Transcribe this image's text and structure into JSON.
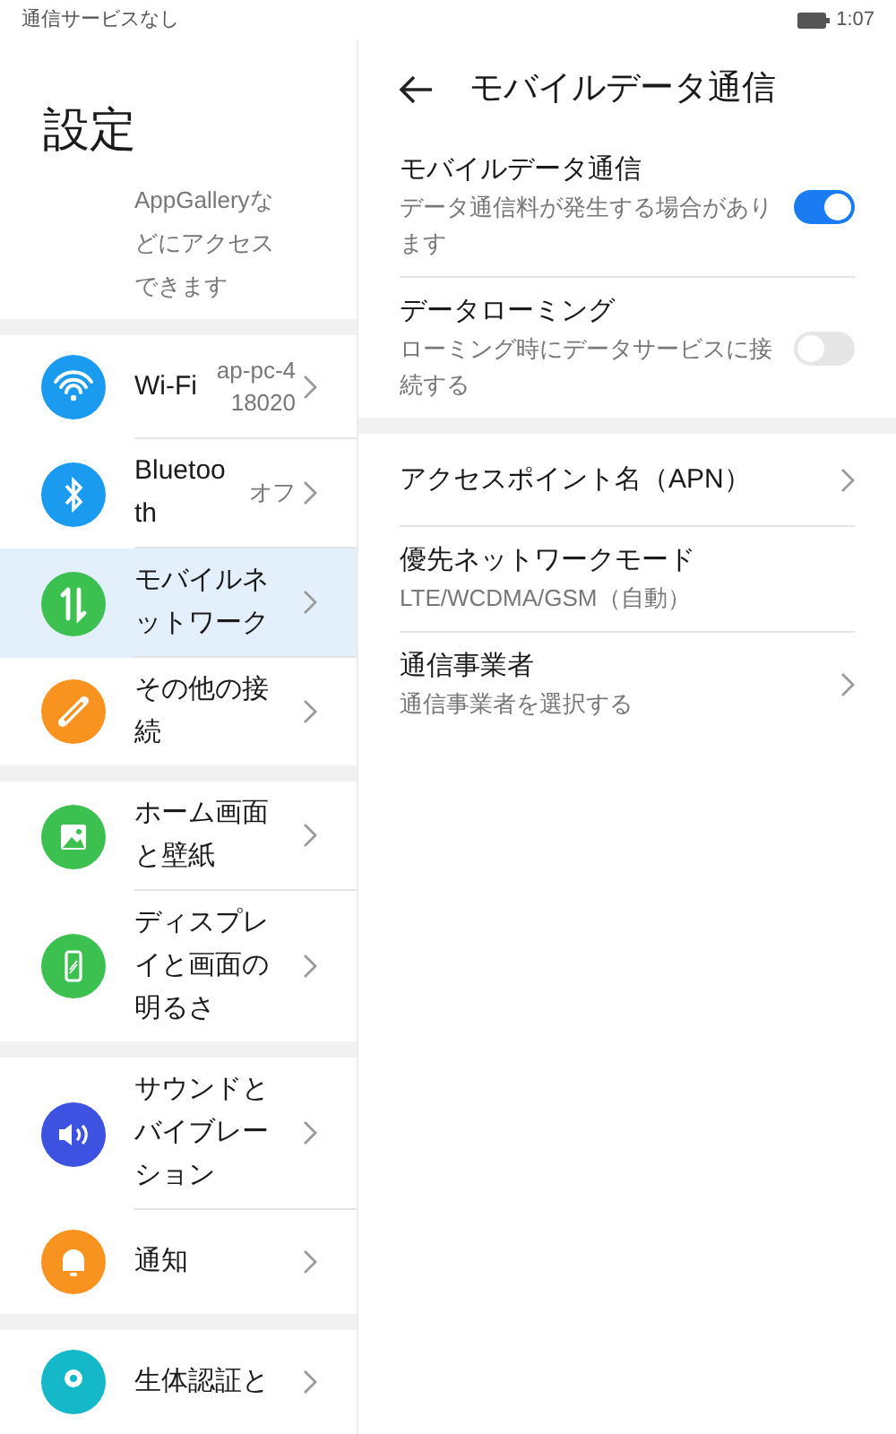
{
  "status_bar": {
    "carrier": "通信サービスなし",
    "time": "1:07"
  },
  "settings": {
    "title": "設定",
    "partial_text": "AppGalleryなどにアクセスできます",
    "groups": [
      {
        "items": [
          {
            "kind": "wifi",
            "color": "#1a9bf0",
            "label": "Wi-Fi",
            "value": "ap-pc-418020",
            "selected": false
          },
          {
            "kind": "bluetooth",
            "color": "#1a9bf0",
            "label": "Bluetooth",
            "value": "オフ",
            "selected": false
          },
          {
            "kind": "updown",
            "color": "#3cc150",
            "label": "モバイルネットワーク",
            "selected": true
          },
          {
            "kind": "link",
            "color": "#f7931e",
            "label": "その他の接続",
            "selected": false
          }
        ]
      },
      {
        "items": [
          {
            "kind": "image",
            "color": "#3cc150",
            "label": "ホーム画面と壁紙",
            "selected": false
          },
          {
            "kind": "phone",
            "color": "#3cc150",
            "label": "ディスプレイと画面の明るさ",
            "selected": false
          }
        ]
      },
      {
        "items": [
          {
            "kind": "sound",
            "color": "#3d52e0",
            "label": "サウンドとバイブレーション",
            "selected": false
          },
          {
            "kind": "bell",
            "color": "#f7931e",
            "label": "通知",
            "selected": false
          }
        ]
      },
      {
        "items": [
          {
            "kind": "pin",
            "color": "#14b8c8",
            "label": "生体認証と",
            "selected": false
          }
        ]
      }
    ]
  },
  "detail": {
    "title": "モバイルデータ通信",
    "groups": [
      {
        "rows": [
          {
            "kind": "toggle",
            "label": "モバイルデータ通信",
            "sub": "データ通信料が発生する場合があります",
            "on": true
          },
          {
            "kind": "toggle",
            "label": "データローミング",
            "sub": "ローミング時にデータサービスに接続する",
            "on": false
          }
        ]
      },
      {
        "rows": [
          {
            "kind": "link",
            "label": "アクセスポイント名（APN）"
          },
          {
            "kind": "info",
            "label": "優先ネットワークモード",
            "sub": "LTE/WCDMA/GSM（自動）"
          },
          {
            "kind": "link",
            "label": "通信事業者",
            "sub": "通信事業者を選択する"
          }
        ]
      }
    ]
  }
}
